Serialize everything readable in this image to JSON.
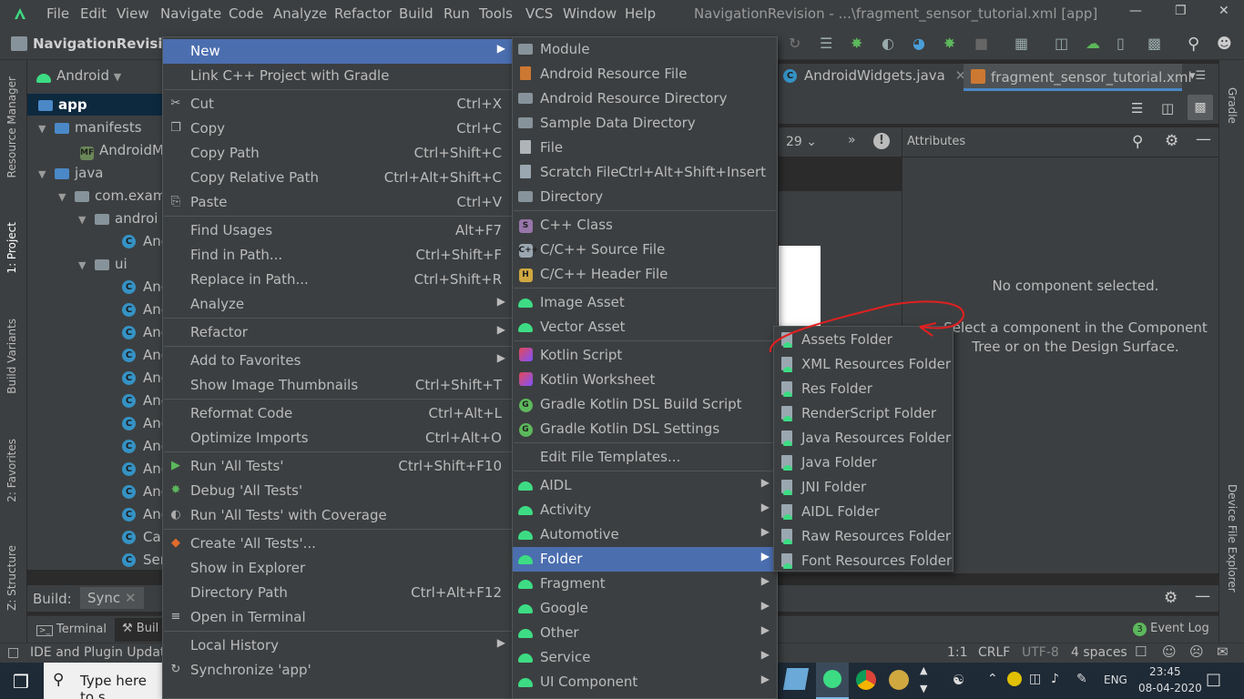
{
  "menubar": {
    "items": [
      "File",
      "Edit",
      "View",
      "Navigate",
      "Code",
      "Analyze",
      "Refactor",
      "Build",
      "Run",
      "Tools",
      "VCS",
      "Window",
      "Help"
    ],
    "title": "NavigationRevision - ...\\fragment_sensor_tutorial.xml [app]"
  },
  "toolbar": {
    "project_name": "NavigationRevision"
  },
  "left_strip": [
    "Resource Manager",
    "1: Project",
    "Build Variants",
    "2: Favorites",
    "Z: Structure"
  ],
  "right_strip": [
    "Gradle",
    "Device File Explorer"
  ],
  "project": {
    "view_selector": "Android",
    "tree": [
      {
        "label": "app",
        "kind": "module"
      },
      {
        "label": "manifests",
        "kind": "folder"
      },
      {
        "label": "AndroidM",
        "kind": "manifest"
      },
      {
        "label": "java",
        "kind": "folder"
      },
      {
        "label": "com.exam",
        "kind": "package"
      },
      {
        "label": "androi",
        "kind": "package"
      },
      {
        "label": "Anc",
        "kind": "class"
      },
      {
        "label": "ui",
        "kind": "package"
      },
      {
        "label": "Anc",
        "kind": "class"
      },
      {
        "label": "Anc",
        "kind": "class"
      },
      {
        "label": "Anc",
        "kind": "class"
      },
      {
        "label": "Anc",
        "kind": "class"
      },
      {
        "label": "Anc",
        "kind": "class"
      },
      {
        "label": "Anc",
        "kind": "class"
      },
      {
        "label": "Anc",
        "kind": "class"
      },
      {
        "label": "Anc",
        "kind": "class"
      },
      {
        "label": "Anc",
        "kind": "class"
      },
      {
        "label": "Anc",
        "kind": "class"
      },
      {
        "label": "Anc",
        "kind": "class"
      },
      {
        "label": "Car",
        "kind": "class"
      },
      {
        "label": "Ser",
        "kind": "class"
      }
    ]
  },
  "editor": {
    "tabs": [
      "AndroidWidgets.java",
      "fragment_sensor_tutorial.xml"
    ],
    "api_level": "29",
    "attributes_title": "Attributes",
    "no_component": "No component selected.",
    "hint": "Select a component in the Component Tree or on the Design Surface."
  },
  "context_menu": {
    "items": [
      {
        "label": "New",
        "shortcut": "",
        "submenu": true,
        "selected": true,
        "icon": ""
      },
      {
        "label": "Link C++ Project with Gradle",
        "shortcut": "",
        "icon": ""
      },
      {
        "sep": true
      },
      {
        "label": "Cut",
        "shortcut": "Ctrl+X",
        "icon": "scissors-icon"
      },
      {
        "label": "Copy",
        "shortcut": "Ctrl+C",
        "icon": "copy-icon"
      },
      {
        "label": "Copy Path",
        "shortcut": "Ctrl+Shift+C",
        "icon": ""
      },
      {
        "label": "Copy Relative Path",
        "shortcut": "Ctrl+Alt+Shift+C",
        "icon": ""
      },
      {
        "label": "Paste",
        "shortcut": "Ctrl+V",
        "icon": "paste-icon"
      },
      {
        "sep": true
      },
      {
        "label": "Find Usages",
        "shortcut": "Alt+F7",
        "icon": ""
      },
      {
        "label": "Find in Path...",
        "shortcut": "Ctrl+Shift+F",
        "icon": ""
      },
      {
        "label": "Replace in Path...",
        "shortcut": "Ctrl+Shift+R",
        "icon": ""
      },
      {
        "label": "Analyze",
        "shortcut": "",
        "submenu": true,
        "icon": ""
      },
      {
        "sep": true
      },
      {
        "label": "Refactor",
        "shortcut": "",
        "submenu": true,
        "icon": ""
      },
      {
        "sep": true
      },
      {
        "label": "Add to Favorites",
        "shortcut": "",
        "submenu": true,
        "icon": ""
      },
      {
        "label": "Show Image Thumbnails",
        "shortcut": "Ctrl+Shift+T",
        "icon": ""
      },
      {
        "sep": true
      },
      {
        "label": "Reformat Code",
        "shortcut": "Ctrl+Alt+L",
        "icon": ""
      },
      {
        "label": "Optimize Imports",
        "shortcut": "Ctrl+Alt+O",
        "icon": ""
      },
      {
        "sep": true
      },
      {
        "label": "Run 'All Tests'",
        "shortcut": "Ctrl+Shift+F10",
        "icon": "run-icon"
      },
      {
        "label": "Debug 'All Tests'",
        "shortcut": "",
        "icon": "debug-icon"
      },
      {
        "label": "Run 'All Tests' with Coverage",
        "shortcut": "",
        "icon": "coverage-icon"
      },
      {
        "sep": true
      },
      {
        "label": "Create 'All Tests'...",
        "shortcut": "",
        "icon": "create-test-icon"
      },
      {
        "label": "Show in Explorer",
        "shortcut": "",
        "icon": ""
      },
      {
        "label": "Directory Path",
        "shortcut": "Ctrl+Alt+F12",
        "icon": ""
      },
      {
        "label": "Open in Terminal",
        "shortcut": "",
        "icon": "terminal-icon"
      },
      {
        "sep": true
      },
      {
        "label": "Local History",
        "shortcut": "",
        "submenu": true,
        "icon": ""
      },
      {
        "label": "Synchronize 'app'",
        "shortcut": "",
        "icon": "sync-icon"
      }
    ]
  },
  "new_menu": {
    "items": [
      {
        "label": "Module",
        "icon": "folder"
      },
      {
        "label": "Android Resource File",
        "icon": "resfile"
      },
      {
        "label": "Android Resource Directory",
        "icon": "folder"
      },
      {
        "label": "Sample Data Directory",
        "icon": "folder"
      },
      {
        "label": "File",
        "icon": "file"
      },
      {
        "label": "Scratch File",
        "shortcut": "Ctrl+Alt+Shift+Insert",
        "icon": "scratch"
      },
      {
        "label": "Directory",
        "icon": "folder"
      },
      {
        "sep": true
      },
      {
        "label": "C++ Class",
        "icon": "cpp-s"
      },
      {
        "label": "C/C++ Source File",
        "icon": "cpp"
      },
      {
        "label": "C/C++ Header File",
        "icon": "h"
      },
      {
        "sep": true
      },
      {
        "label": "Image Asset",
        "icon": "android"
      },
      {
        "label": "Vector Asset",
        "icon": "android"
      },
      {
        "sep": true
      },
      {
        "label": "Kotlin Script",
        "icon": "kotlin"
      },
      {
        "label": "Kotlin Worksheet",
        "icon": "kotlin"
      },
      {
        "label": "Gradle Kotlin DSL Build Script",
        "icon": "gradle"
      },
      {
        "label": "Gradle Kotlin DSL Settings",
        "icon": "gradle"
      },
      {
        "sep": true
      },
      {
        "label": "Edit File Templates...",
        "icon": ""
      },
      {
        "sep": true
      },
      {
        "label": "AIDL",
        "icon": "android",
        "submenu": true
      },
      {
        "label": "Activity",
        "icon": "android",
        "submenu": true
      },
      {
        "label": "Automotive",
        "icon": "android",
        "submenu": true
      },
      {
        "label": "Folder",
        "icon": "android",
        "submenu": true,
        "selected": true
      },
      {
        "label": "Fragment",
        "icon": "android",
        "submenu": true
      },
      {
        "label": "Google",
        "icon": "android",
        "submenu": true
      },
      {
        "label": "Other",
        "icon": "android",
        "submenu": true
      },
      {
        "label": "Service",
        "icon": "android",
        "submenu": true
      },
      {
        "label": "UI Component",
        "icon": "android",
        "submenu": true
      }
    ]
  },
  "folder_menu": {
    "items": [
      "Assets Folder",
      "XML Resources Folder",
      "Res Folder",
      "RenderScript Folder",
      "Java Resources Folder",
      "Java Folder",
      "JNI Folder",
      "AIDL Folder",
      "Raw Resources Folder",
      "Font Resources Folder"
    ]
  },
  "build_bar": {
    "label": "Build:",
    "tab": "Sync"
  },
  "bottom_tabs": {
    "terminal": "Terminal",
    "build": "Buil",
    "event_log": "Event Log",
    "event_count": "3"
  },
  "status": {
    "message": "IDE and Plugin Update",
    "position": "1:1",
    "line_sep": "CRLF",
    "encoding": "UTF-8",
    "indent": "4 spaces"
  },
  "taskbar": {
    "search_placeholder": "Type here to s",
    "lang": "ENG",
    "time": "23:45",
    "date": "08-04-2020"
  },
  "colors": {
    "selection": "#4b6eaf",
    "panel": "#3c3f41",
    "annotation": "#e02020"
  }
}
